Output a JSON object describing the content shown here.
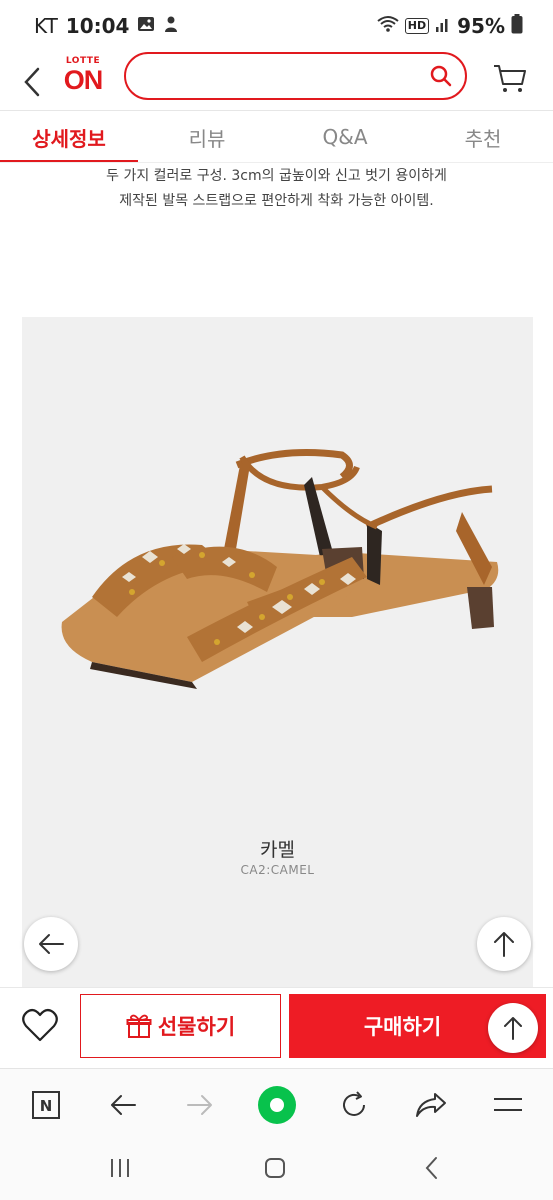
{
  "status_bar": {
    "carrier": "KT",
    "time": "10:04",
    "hd": "HD",
    "battery": "95%"
  },
  "header": {
    "logo_small": "LOTTE",
    "logo_big": "ON",
    "search_value": "",
    "search_placeholder": ""
  },
  "tabs": [
    {
      "label": "상세정보",
      "active": true
    },
    {
      "label": "리뷰",
      "active": false
    },
    {
      "label": "Q&A",
      "active": false
    },
    {
      "label": "추천",
      "active": false
    }
  ],
  "description": {
    "line1": "두 가지 컬러로 구성. 3cm의 굽높이와 신고 벗기 용이하게",
    "line2": "제작된 발목 스트랩으로 편안하게 착화 가능한 아이템."
  },
  "product": {
    "color_name": "카멜",
    "color_code": "CA2:CAMEL"
  },
  "action_bar": {
    "gift_label": "선물하기",
    "buy_label": "구매하기"
  },
  "browser_bar": {
    "naver_letter": "N"
  },
  "colors": {
    "brand_red": "#e1191e",
    "buy_red": "#ee1c25",
    "sandal_camel": "#b27336",
    "green_home": "#08c24c"
  },
  "icons": [
    "back-arrow-icon",
    "search-icon",
    "cart-icon",
    "left-arrow-icon",
    "up-arrow-icon",
    "heart-icon",
    "gift-icon",
    "naver-icon",
    "reload-icon",
    "share-icon",
    "menu-icon"
  ]
}
